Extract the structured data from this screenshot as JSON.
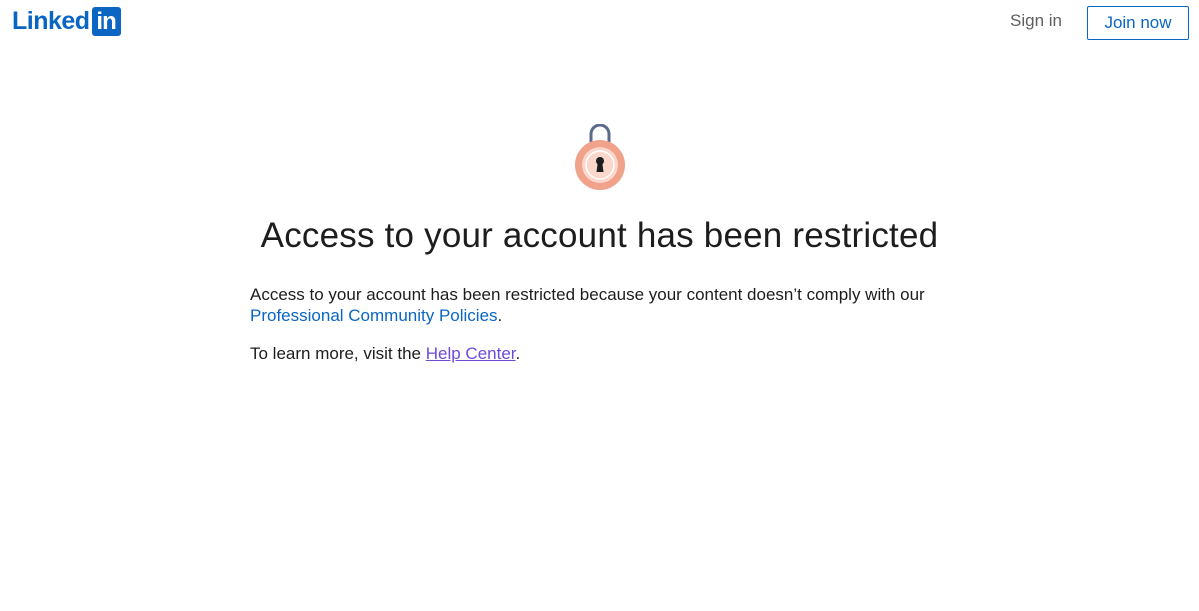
{
  "header": {
    "logo_text": "Linked",
    "logo_box_text": "in",
    "signin_label": "Sign in",
    "join_label": "Join now"
  },
  "main": {
    "icon": "lock-icon",
    "title": "Access to your account has been restricted",
    "message": "Access to your account has been restricted because your content doesn’t comply with our",
    "policy_link": "Professional Community Policies",
    "policy_suffix": ".",
    "learn_prefix": "To learn more, visit the ",
    "help_link": "Help Center",
    "learn_suffix": "."
  },
  "colors": {
    "brand": "#0a66c2",
    "link_visited": "#6f4ad9",
    "lock_outer": "#f0a28b",
    "lock_inner": "#fbd7cb",
    "shackle": "#5a6b8c",
    "text": "#1d1d1d"
  }
}
